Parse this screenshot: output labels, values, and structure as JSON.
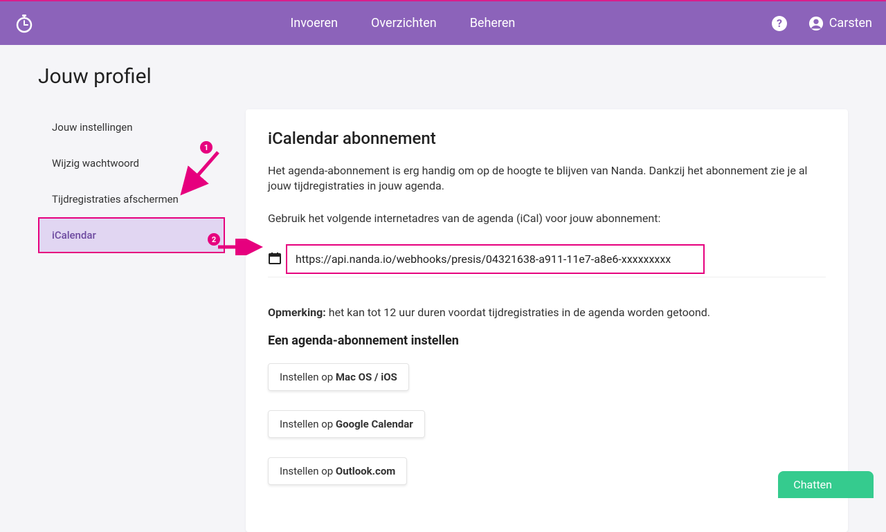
{
  "nav": {
    "items": [
      "Invoeren",
      "Overzichten",
      "Beheren"
    ]
  },
  "user": {
    "name": "Carsten"
  },
  "page": {
    "title": "Jouw profiel"
  },
  "sidebar": {
    "items": [
      {
        "label": "Jouw instellingen"
      },
      {
        "label": "Wijzig wachtwoord"
      },
      {
        "label": "Tijdregistraties afschermen"
      },
      {
        "label": "iCalendar"
      }
    ]
  },
  "card": {
    "heading": "iCalendar abonnement",
    "intro": "Het agenda-abonnement is erg handig om op de hoogte te blijven van Nanda. Dankzij het abonnement zie je al jouw tijdregistraties in jouw agenda.",
    "prompt": "Gebruik het volgende internetadres van de agenda (iCal) voor jouw abonnement:",
    "url": "https://api.nanda.io/webhooks/presis/04321638-a911-11e7-a8e6-xxxxxxxxx",
    "note_label": "Opmerking:",
    "note_text": " het kan tot 12 uur duren voordat tijdregistraties in de agenda worden getoond.",
    "subheading": "Een agenda-abonnement instellen",
    "buttons": [
      {
        "prefix": "Instellen op ",
        "bold": "Mac OS / iOS"
      },
      {
        "prefix": "Instellen op ",
        "bold": "Google Calendar"
      },
      {
        "prefix": "Instellen op ",
        "bold": "Outlook.com"
      }
    ]
  },
  "chat": {
    "label": "Chatten"
  },
  "annotations": {
    "one": "1",
    "two": "2"
  }
}
